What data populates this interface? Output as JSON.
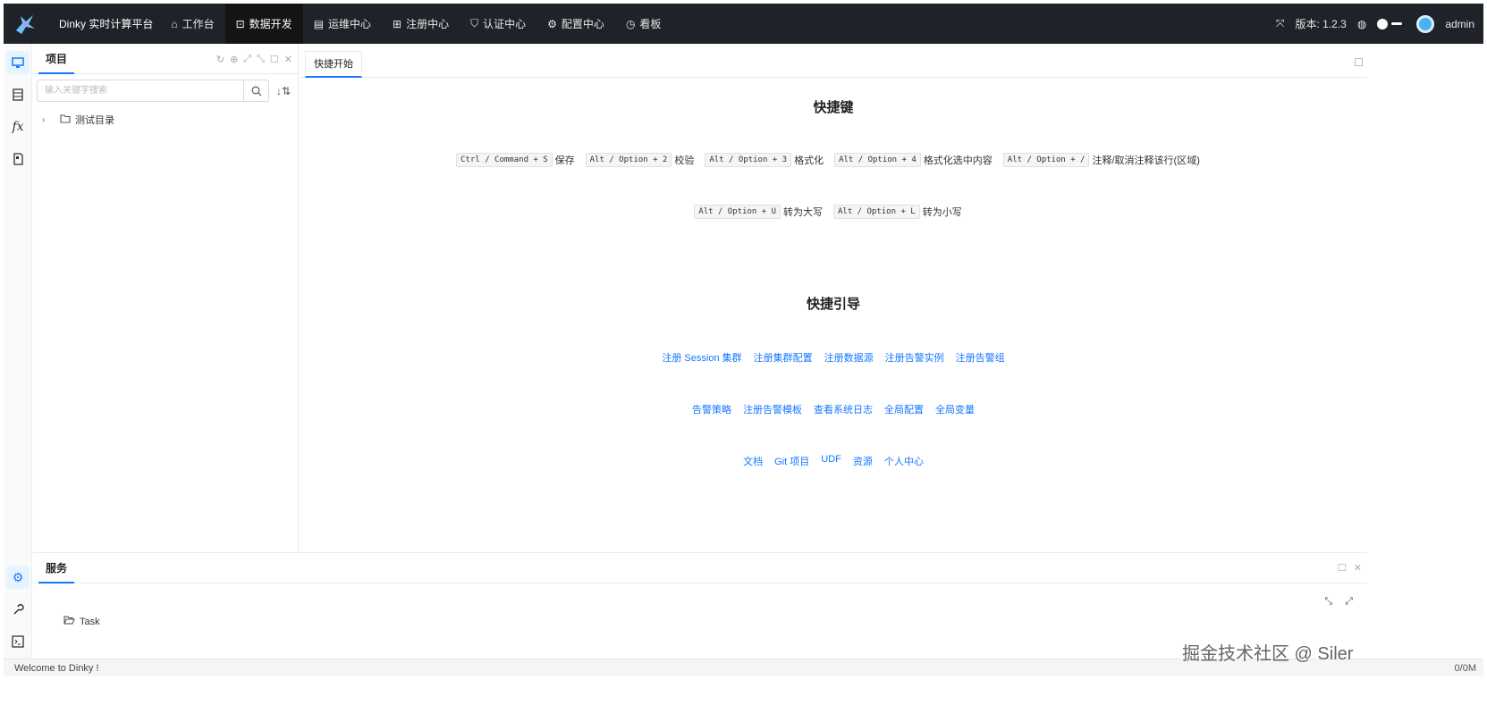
{
  "header": {
    "app_title": "Dinky 实时计算平台",
    "nav": [
      {
        "icon": "⌂",
        "label": "工作台"
      },
      {
        "icon": "⊡",
        "label": "数据开发"
      },
      {
        "icon": "▤",
        "label": "运维中心"
      },
      {
        "icon": "⊞",
        "label": "注册中心"
      },
      {
        "icon": "⛉",
        "label": "认证中心"
      },
      {
        "icon": "⚙",
        "label": "配置中心"
      },
      {
        "icon": "◷",
        "label": "看板"
      }
    ],
    "active_nav": "数据开发",
    "version": "版本: 1.2.3",
    "user": "admin"
  },
  "project_panel": {
    "tab": "项目",
    "search_placeholder": "输入关键字搜索",
    "tree": [
      {
        "label": "测试目录"
      }
    ]
  },
  "editor": {
    "tab": "快捷开始",
    "shortcuts_title": "快捷键",
    "shortcuts_row1": [
      {
        "key": "Ctrl / Command + S",
        "desc": "保存"
      },
      {
        "key": "Alt / Option + 2",
        "desc": "校验"
      },
      {
        "key": "Alt / Option + 3",
        "desc": "格式化"
      },
      {
        "key": "Alt / Option + 4",
        "desc": "格式化选中内容"
      },
      {
        "key": "Alt / Option + /",
        "desc": "注释/取消注释该行(区域)"
      }
    ],
    "shortcuts_row2": [
      {
        "key": "Alt / Option + U",
        "desc": "转为大写"
      },
      {
        "key": "Alt / Option + L",
        "desc": "转为小写"
      }
    ],
    "guide_title": "快捷引导",
    "guide_row1": [
      "注册 Session 集群",
      "注册集群配置",
      "注册数据源",
      "注册告警实例",
      "注册告警组"
    ],
    "guide_row2": [
      "告警策略",
      "注册告警模板",
      "查看系统日志",
      "全局配置",
      "全局变量"
    ],
    "guide_row3": [
      "文档",
      "Git 项目",
      "UDF",
      "资源",
      "个人中心"
    ]
  },
  "service_panel": {
    "tab": "服务",
    "task_label": "Task"
  },
  "status": {
    "message": "Welcome to Dinky !",
    "memory": "0/0M"
  },
  "watermark": "掘金技术社区 @ Siler",
  "colors": {
    "topbar": "#1f2329",
    "accent": "#1677ff"
  }
}
